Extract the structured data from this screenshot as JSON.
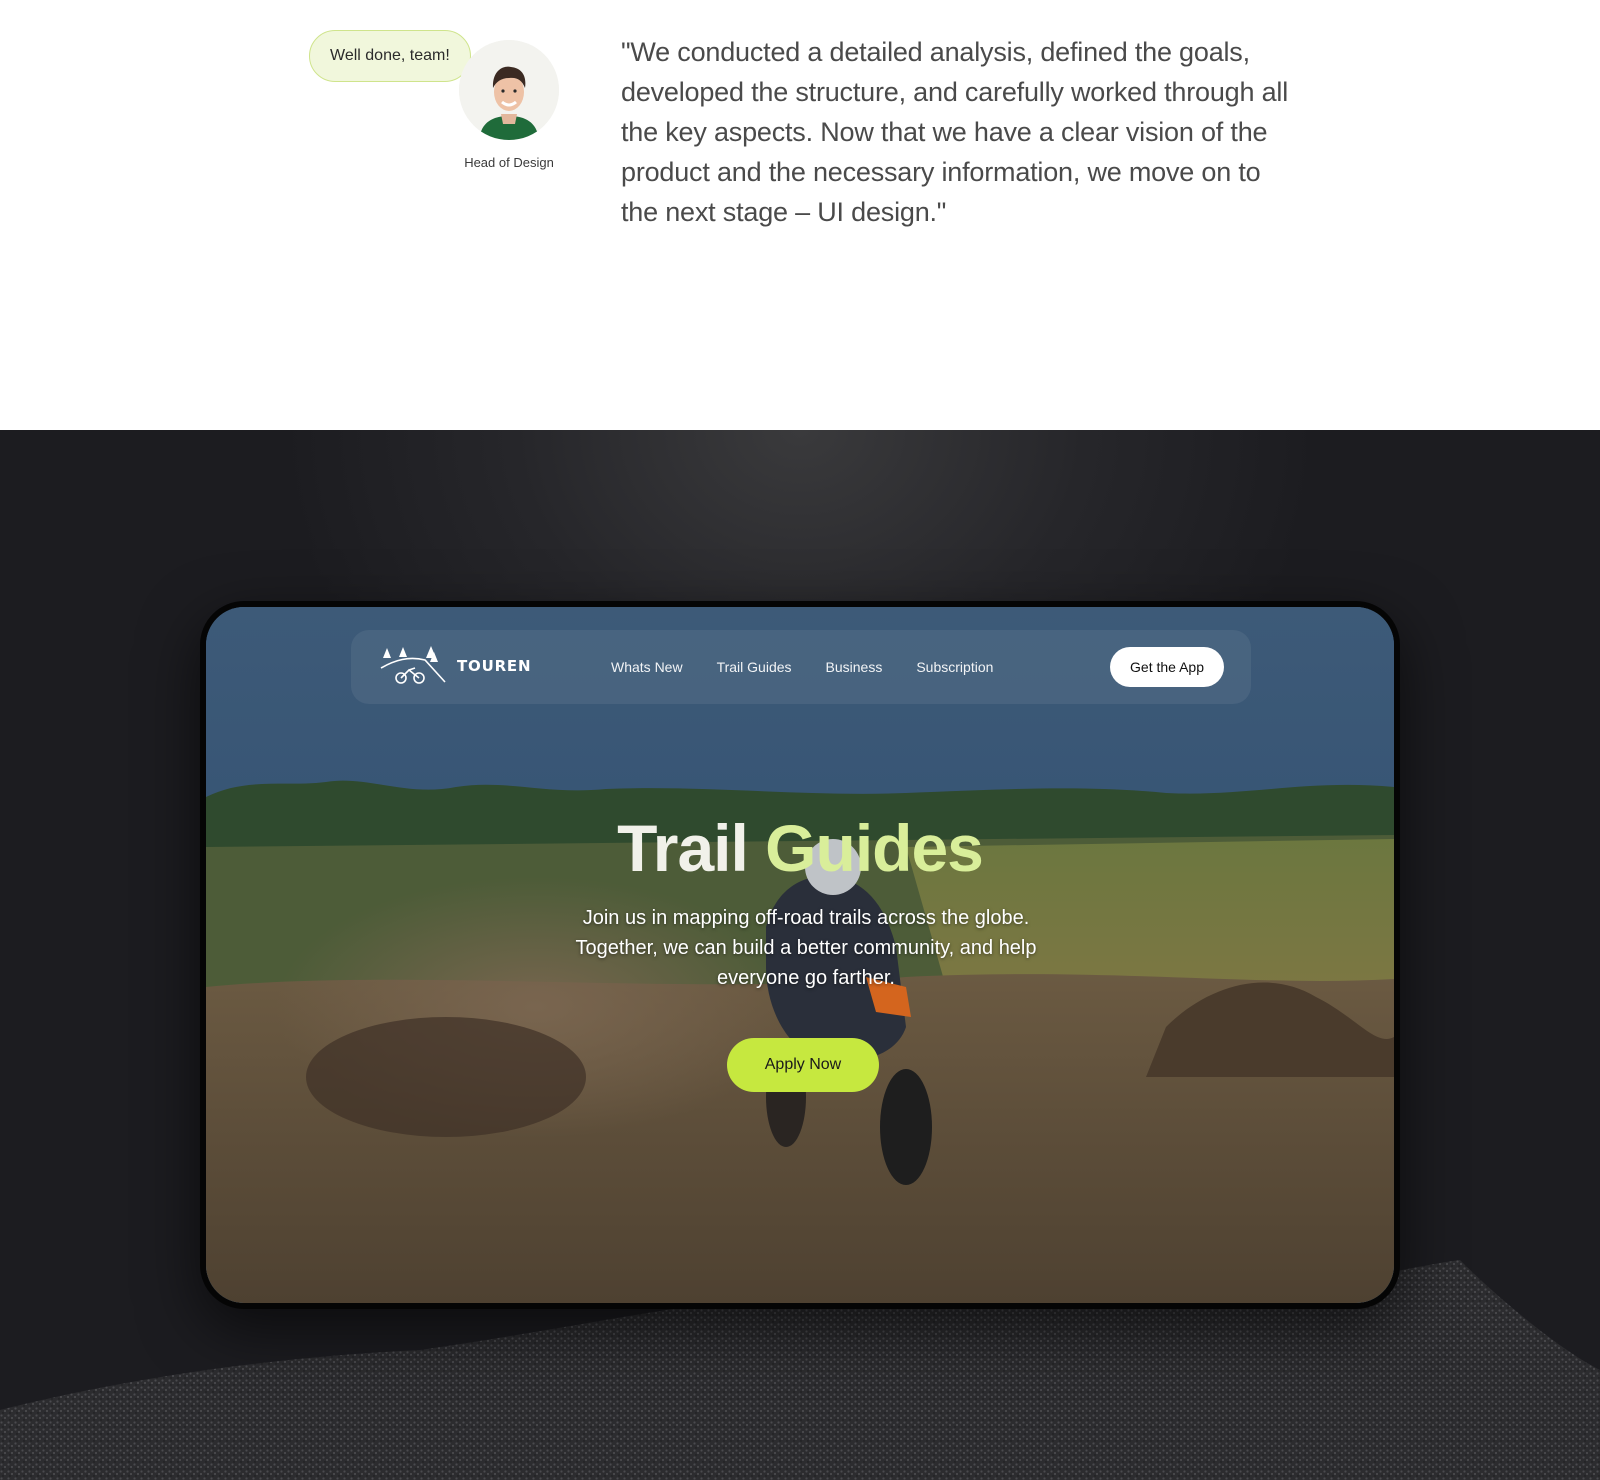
{
  "testimonial": {
    "bubble_text": "Well done, team!",
    "role": "Head of Design",
    "quote": "\"We conducted a detailed analysis, defined the goals, developed the structure, and carefully worked through all the key aspects. Now that we have a clear vision of the product and the necessary information, we move on to the next stage – UI design.\""
  },
  "site": {
    "brand": "TOUREN",
    "nav": [
      {
        "label": "Whats New"
      },
      {
        "label": "Trail Guides"
      },
      {
        "label": "Business"
      },
      {
        "label": "Subscription"
      }
    ],
    "cta_label": "Get the App",
    "hero": {
      "title_part1": "Trail ",
      "title_part2": "Guides",
      "subtitle": "Join us in mapping off-road trails across the globe. Together, we can build a better community, and help everyone go farther.",
      "button_label": "Apply Now"
    }
  },
  "colors": {
    "accent": "#c6e83f",
    "title_accent": "#d9ee9a",
    "bubble_bg": "#f1f7dc",
    "dark_bg": "#1c1c20"
  },
  "icons": {
    "logo": "trees-motorbike-logo-icon",
    "avatar": "person-avatar"
  }
}
